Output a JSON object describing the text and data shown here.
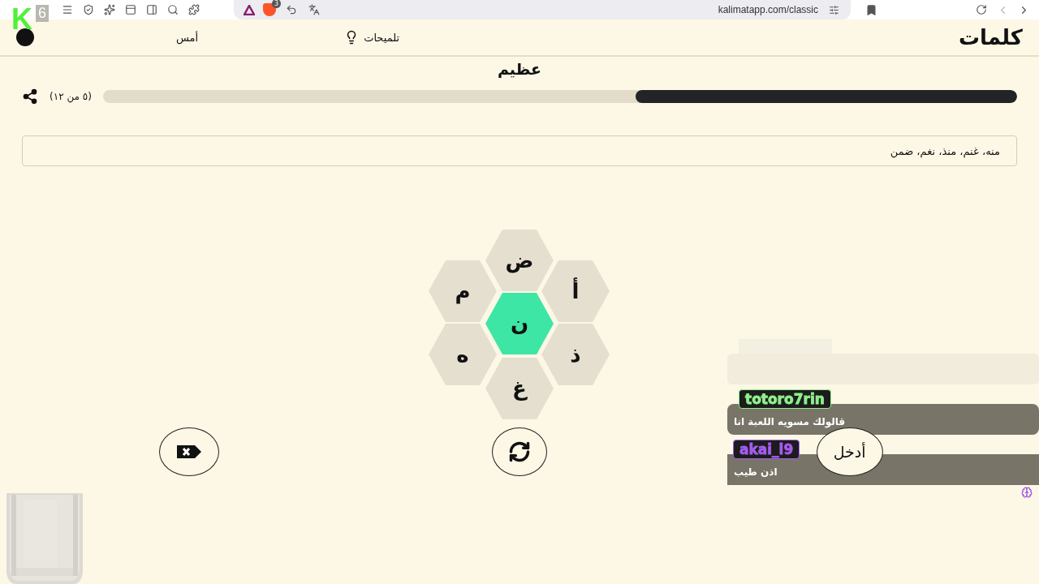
{
  "browser": {
    "url": "kalimatapp.com/classic",
    "extension_badge": "3"
  },
  "header": {
    "logo": "كلمات",
    "hints": "تلميحات",
    "yesterday": "أمس"
  },
  "title": "عظيم",
  "progress": {
    "level": 0.417,
    "reading": "(٥ من ١٢)"
  },
  "found_words": "منه، غنم، منذ، نغم، ضمن",
  "letters": [
    {
      "letter": "ض",
      "kind": "outer"
    },
    {
      "letter": "م",
      "kind": "outer"
    },
    {
      "letter": "أ",
      "kind": "outer"
    },
    {
      "letter": "ن",
      "kind": "center"
    },
    {
      "letter": "ه",
      "kind": "outer"
    },
    {
      "letter": "ذ",
      "kind": "outer"
    },
    {
      "letter": "غ",
      "kind": "outer"
    }
  ],
  "enter_button": "أدخل",
  "stream": {
    "logo": "K",
    "viewer_count": "6",
    "chat": [
      {
        "user": "totoro7rin",
        "color": "#8ef08a",
        "message": "قالولك مسويه اللعبة انا"
      },
      {
        "user": "akai_l9",
        "color": "#a45cf0",
        "message": "اذن طيب"
      }
    ]
  }
}
